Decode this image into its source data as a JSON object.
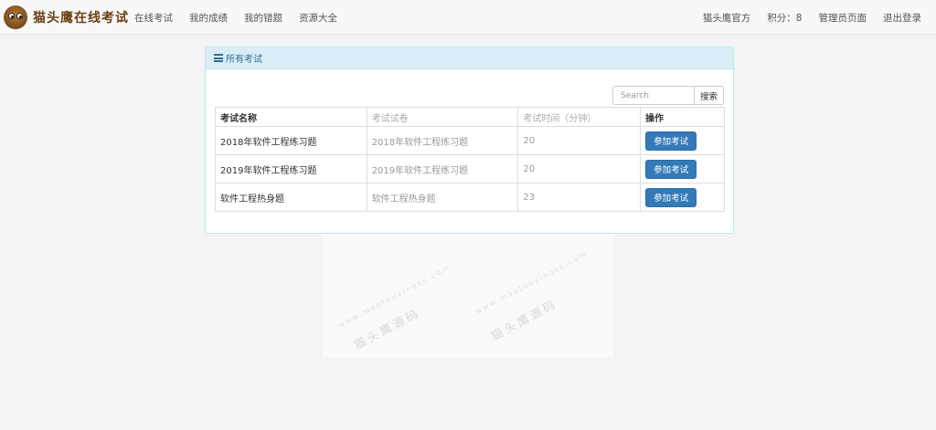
{
  "brand": {
    "title": "猫头鹰在线考试"
  },
  "nav": {
    "left": [
      "在线考试",
      "我的成绩",
      "我的错题",
      "资源大全"
    ],
    "right": {
      "user": "猫头鹰官方",
      "points": "积分：8",
      "admin": "管理员页面",
      "logout": "退出登录"
    }
  },
  "panel": {
    "heading": "所有考试",
    "icon": "list-icon",
    "search": {
      "placeholder": "Search",
      "button": "搜索"
    },
    "columns": [
      "考试名称",
      "考试试卷",
      "考试时间（分钟）",
      "操作"
    ],
    "rows": [
      {
        "name": "2018年软件工程练习题",
        "paper": "2018年软件工程练习题",
        "minutes": "20",
        "action": "参加考试"
      },
      {
        "name": "2019年软件工程练习题",
        "paper": "2019年软件工程练习题",
        "minutes": "20",
        "action": "参加考试"
      },
      {
        "name": "软件工程热身题",
        "paper": "软件工程热身题",
        "minutes": "23",
        "action": "参加考试"
      }
    ]
  },
  "watermark": {
    "url": "www.maotouyingsc.com",
    "text": "猫头鹰源码"
  },
  "colors": {
    "primary": "#337ab7",
    "panel_heading_bg": "#d9edf7",
    "panel_border": "#bce8f1",
    "brand": "#6b3f12"
  }
}
